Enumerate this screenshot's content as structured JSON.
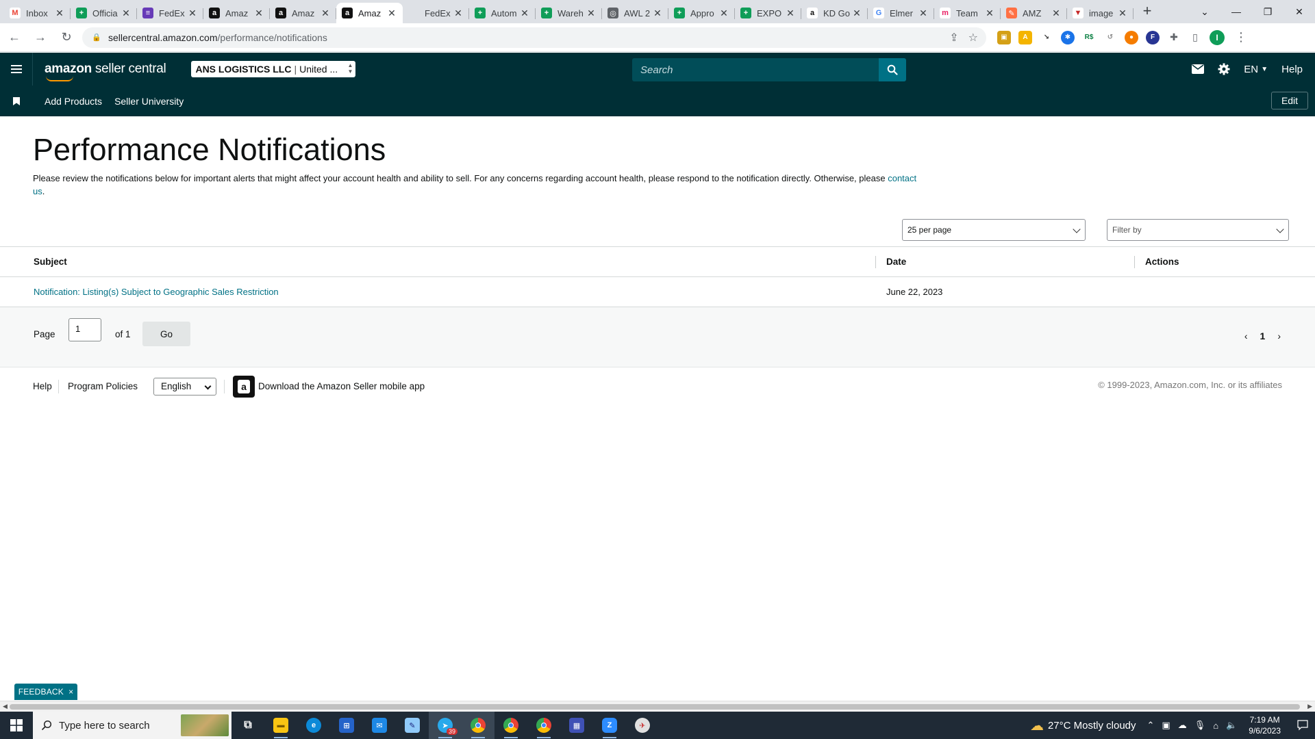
{
  "browser": {
    "tabs": [
      {
        "label": "Inbox",
        "fav_color": "#ffffff",
        "fav_text": "M",
        "fav_text_color": "#ea4335"
      },
      {
        "label": "Officia",
        "fav_color": "#0f9d58",
        "fav_text": "+"
      },
      {
        "label": "FedEx",
        "fav_color": "#673ab7",
        "fav_text": "≡"
      },
      {
        "label": "Amaz",
        "fav_color": "#111111",
        "fav_text": "a"
      },
      {
        "label": "Amaz",
        "fav_color": "#111111",
        "fav_text": "a"
      },
      {
        "label": "Amaz",
        "fav_color": "#111111",
        "fav_text": "a",
        "active": true
      },
      {
        "label": "FedEx",
        "fav_color": "transparent",
        "fav_text": ""
      },
      {
        "label": "Autom",
        "fav_color": "#0f9d58",
        "fav_text": "+"
      },
      {
        "label": "Wareh",
        "fav_color": "#0f9d58",
        "fav_text": "+"
      },
      {
        "label": "AWL 2",
        "fav_color": "#5f6368",
        "fav_text": "◎"
      },
      {
        "label": "Appro",
        "fav_color": "#0f9d58",
        "fav_text": "+"
      },
      {
        "label": "EXPO",
        "fav_color": "#0f9d58",
        "fav_text": "+"
      },
      {
        "label": "KD Go",
        "fav_color": "#ffffff",
        "fav_text": "a",
        "fav_text_color": "#111"
      },
      {
        "label": "Elmer",
        "fav_color": "#ffffff",
        "fav_text": "G",
        "fav_text_color": "#4285f4"
      },
      {
        "label": "Team",
        "fav_color": "#ffffff",
        "fav_text": "m",
        "fav_text_color": "#e91e63"
      },
      {
        "label": "AMZ",
        "fav_color": "#ff7043",
        "fav_text": "✎"
      },
      {
        "label": "image",
        "fav_color": "#ffffff",
        "fav_text": "▼",
        "fav_text_color": "#c62828"
      }
    ],
    "url_host": "sellercentral.amazon.com",
    "url_path": "/performance/notifications"
  },
  "header": {
    "logo_bold": "amazon",
    "logo_rest": " seller central",
    "account_bold": "ANS LOGISTICS LLC",
    "account_rest": "United ...",
    "search_placeholder": "Search",
    "language": "EN",
    "help": "Help"
  },
  "subnav": {
    "links": [
      "Add Products",
      "Seller University"
    ],
    "edit": "Edit"
  },
  "page": {
    "title": "Performance Notifications",
    "description": "Please review the notifications below for important alerts that might affect your account health and ability to sell. For any concerns regarding account health, please respond to the notification directly. Otherwise, please",
    "contact_link": "contact us",
    "description_end": "."
  },
  "controls": {
    "per_page": "25 per page",
    "filter_placeholder": "Filter by"
  },
  "table": {
    "columns": [
      "Subject",
      "Date",
      "Actions"
    ],
    "rows": [
      {
        "subject": "Notification: Listing(s) Subject to Geographic Sales Restriction",
        "date": "June 22, 2023",
        "actions": ""
      }
    ]
  },
  "pagination": {
    "page_label": "Page",
    "current": "1",
    "of_label": "of 1",
    "go": "Go",
    "page_number": "1"
  },
  "footer": {
    "help": "Help",
    "policies": "Program Policies",
    "language": "English",
    "app_text": "Download the Amazon Seller mobile app",
    "copyright": "© 1999-2023, Amazon.com, Inc. or its affiliates"
  },
  "feedback": {
    "label": "FEEDBACK",
    "close": "×"
  },
  "taskbar": {
    "search_placeholder": "Type here to search",
    "weather": "27°C  Mostly cloudy",
    "time": "7:19 AM",
    "date": "9/6/2023",
    "badge": "39"
  }
}
